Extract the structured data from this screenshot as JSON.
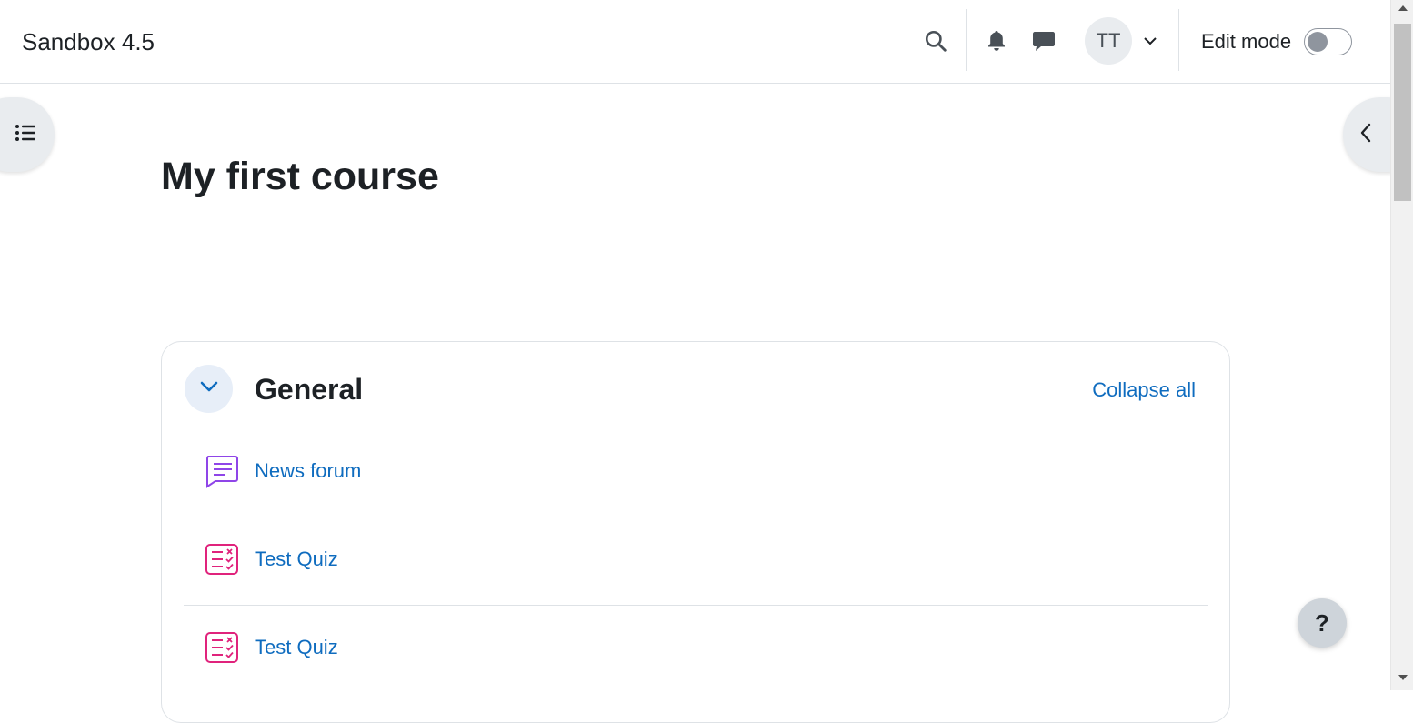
{
  "header": {
    "site_name": "Sandbox 4.5",
    "user_initials": "TT",
    "edit_mode_label": "Edit mode",
    "edit_mode_on": false
  },
  "icons": {
    "search": "search-icon",
    "notifications": "bell-icon",
    "messages": "chat-bubble-icon",
    "user_menu": "chevron-down-icon",
    "course_index": "list-icon",
    "block_drawer": "chevron-left-icon",
    "section_toggle": "chevron-down-icon",
    "help": "question-icon"
  },
  "course": {
    "title": "My first course"
  },
  "section": {
    "name": "General",
    "collapse_all_label": "Collapse all",
    "activities": [
      {
        "type": "forum",
        "name": "News forum",
        "icon": "forum-icon"
      },
      {
        "type": "quiz",
        "name": "Test Quiz",
        "icon": "quiz-icon"
      },
      {
        "type": "quiz",
        "name": "Test Quiz",
        "icon": "quiz-icon"
      }
    ]
  },
  "help": {
    "label": "?"
  },
  "colors": {
    "link": "#0f6cbf",
    "forum_icon": "#8f45e8",
    "quiz_icon": "#e0237c",
    "text": "#1d2125"
  }
}
